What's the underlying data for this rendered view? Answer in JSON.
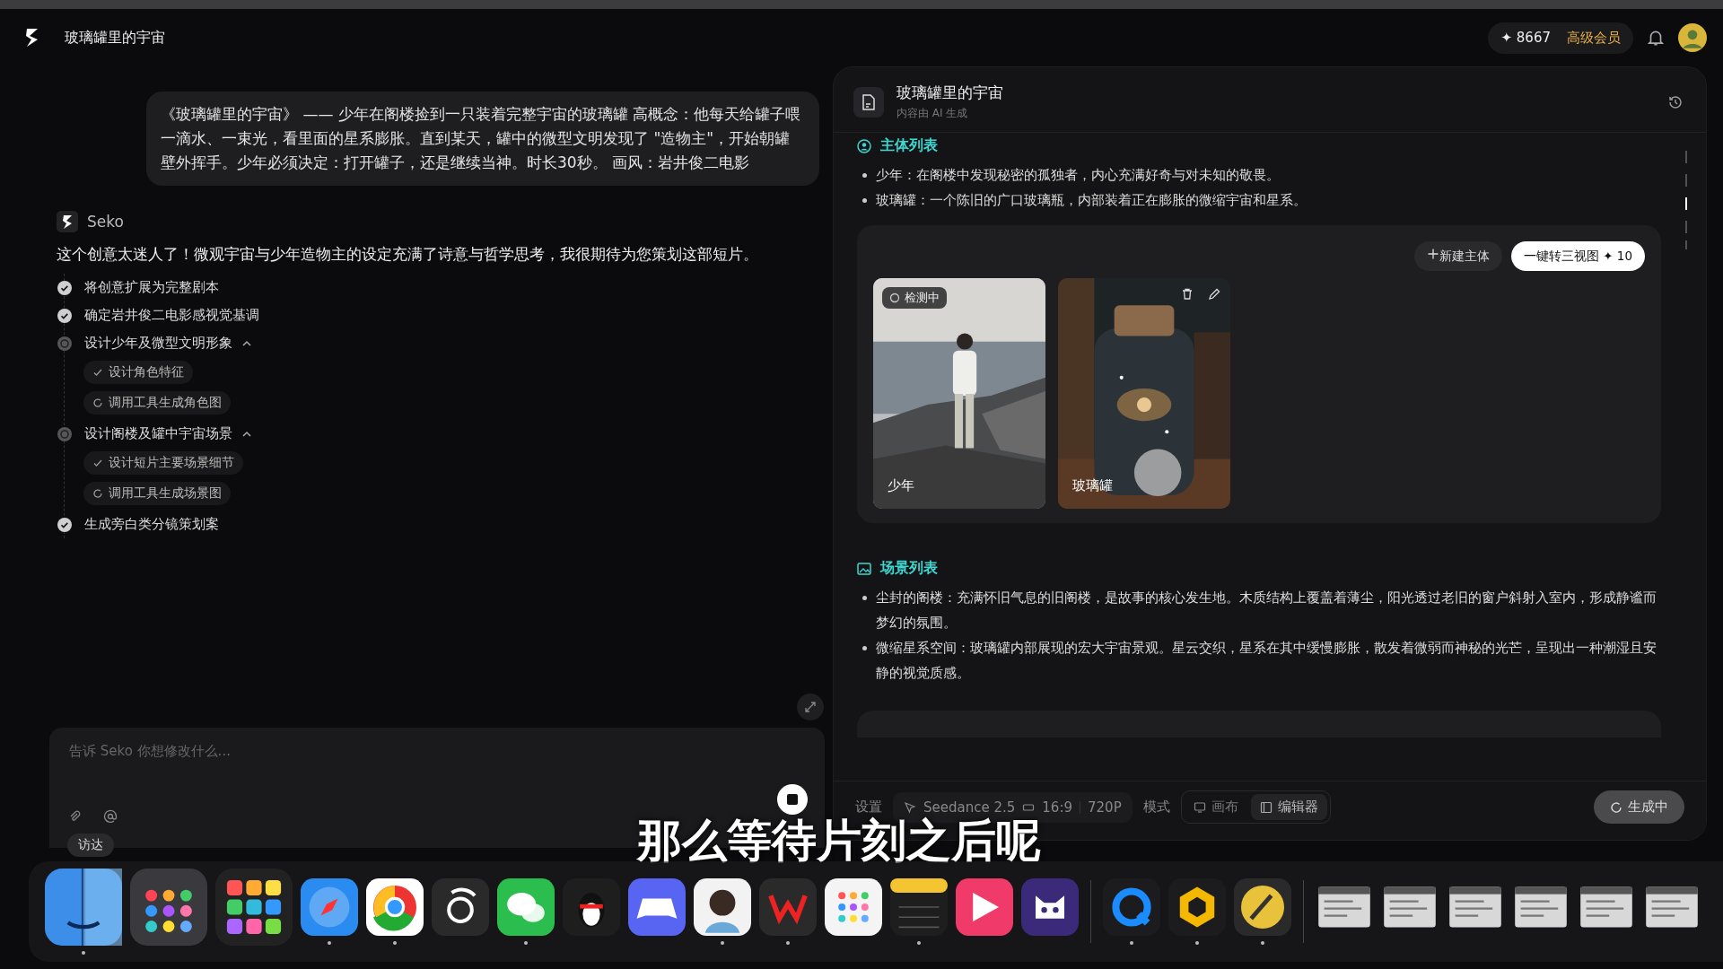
{
  "app": {
    "title": "玻璃罐里的宇宙",
    "credits": "✦ 8667",
    "membership": "高级会员"
  },
  "chat": {
    "user_message": "《玻璃罐里的宇宙》 —— 少年在阁楼捡到一只装着完整宇宙的玻璃罐 高概念：他每天给罐子喂一滴水、一束光，看里面的星系膨胀。直到某天，罐中的微型文明发现了 \"造物主\"，开始朝罐壁外挥手。少年必须决定：打开罐子，还是继续当神。时长30秒。 画风：岩井俊二电影",
    "assistant_name": "Seko",
    "assistant_message": "这个创意太迷人了！微观宇宙与少年造物主的设定充满了诗意与哲学思考，我很期待为您策划这部短片。",
    "steps": [
      {
        "label": "将创意扩展为完整剧本",
        "done": true
      },
      {
        "label": "确定岩井俊二电影感视觉基调",
        "done": true
      },
      {
        "label": "设计少年及微型文明形象",
        "done": false,
        "expanded": true,
        "children": [
          {
            "label": "设计角色特征",
            "done": true
          },
          {
            "label": "调用工具生成角色图",
            "done": false
          }
        ]
      },
      {
        "label": "设计阁楼及罐中宇宙场景",
        "done": false,
        "expanded": true,
        "children": [
          {
            "label": "设计短片主要场景细节",
            "done": true
          },
          {
            "label": "调用工具生成场景图",
            "done": false
          }
        ]
      },
      {
        "label": "生成旁白类分镜策划案",
        "done": true
      }
    ],
    "input": {
      "placeholder": "告诉 Seko 你想修改什么..."
    },
    "tooltip": "访达"
  },
  "document": {
    "title": "玻璃罐里的宇宙",
    "subtitle": "内容由 AI 生成",
    "subjects": {
      "heading": "主体列表",
      "items": [
        "少年：在阁楼中发现秘密的孤独者，内心充满好奇与对未知的敬畏。",
        "玻璃罐：一个陈旧的广口玻璃瓶，内部装着正在膨胀的微缩宇宙和星系。"
      ],
      "new_button": "新建主体",
      "convert_button": {
        "label": "一键转三视图",
        "cost": "✦ 10"
      },
      "cards": [
        {
          "label": "少年",
          "badge": "检测中",
          "editable": false
        },
        {
          "label": "玻璃罐",
          "editable": true
        }
      ]
    },
    "scenes": {
      "heading": "场景列表",
      "items": [
        "尘封的阁楼：充满怀旧气息的旧阁楼，是故事的核心发生地。木质结构上覆盖着薄尘，阳光透过老旧的窗户斜射入室内，形成静谧而梦幻的氛围。",
        "微缩星系空间：玻璃罐内部展现的宏大宇宙景观。星云交织，星系在其中缓慢膨胀，散发着微弱而神秘的光芒，呈现出一种潮湿且安静的视觉质感。"
      ]
    }
  },
  "toolbar": {
    "settings_label": "设置",
    "model": "Seedance 2.5",
    "ratio": "16:9",
    "resolution": "720P",
    "mode_label": "模式",
    "modes": [
      {
        "label": "画布",
        "selected": false
      },
      {
        "label": "编辑器",
        "selected": true
      }
    ],
    "generate_button": "生成中"
  },
  "caption": "那么等待片刻之后呢",
  "dock": {
    "apps": [
      {
        "kind": "finder",
        "running": true
      },
      {
        "kind": "launchpad",
        "running": false
      },
      {
        "kind": "grid",
        "running": false
      },
      {
        "kind": "compass",
        "running": true
      },
      {
        "kind": "browser",
        "running": true
      },
      {
        "kind": "swirl",
        "running": false
      },
      {
        "kind": "chat",
        "running": true
      },
      {
        "kind": "penguin",
        "running": false
      },
      {
        "kind": "gamepad",
        "running": false
      },
      {
        "kind": "avatar",
        "running": true
      },
      {
        "kind": "letter",
        "running": true
      },
      {
        "kind": "dots",
        "running": false
      },
      {
        "kind": "notes",
        "running": true
      },
      {
        "kind": "play",
        "running": false
      },
      {
        "kind": "cat",
        "running": false
      },
      {
        "kind": "separator"
      },
      {
        "kind": "qring",
        "running": true
      },
      {
        "kind": "hexagon",
        "running": true
      },
      {
        "kind": "broom",
        "running": true
      },
      {
        "kind": "separator"
      },
      {
        "kind": "window"
      },
      {
        "kind": "window"
      },
      {
        "kind": "window"
      },
      {
        "kind": "window"
      },
      {
        "kind": "window"
      },
      {
        "kind": "window"
      }
    ]
  }
}
